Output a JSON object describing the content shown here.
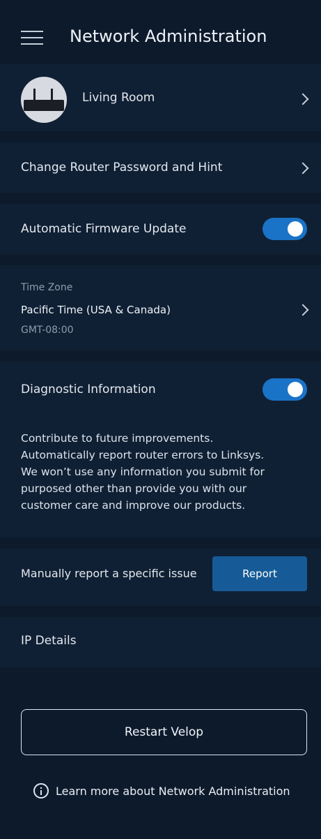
{
  "header": {
    "title": "Network Administration"
  },
  "device": {
    "name": "Living Room"
  },
  "password_row": {
    "label": "Change Router Password and Hint"
  },
  "firmware": {
    "label": "Automatic Firmware Update",
    "enabled": true
  },
  "timezone": {
    "label": "Time Zone",
    "value": "Pacific Time (USA & Canada)",
    "offset": "GMT-08:00"
  },
  "diagnostic": {
    "label": "Diagnostic Information",
    "enabled": true,
    "description": [
      "Contribute to future improvements.",
      "Automatically report router errors to Linksys.",
      "We won’t use any information you submit for",
      "purposed other than provide you with our",
      "customer care and improve our products."
    ]
  },
  "report": {
    "label": "Manually report a specific issue",
    "button_label": "Report"
  },
  "ip": {
    "label": "IP Details"
  },
  "restart": {
    "label": "Restart Velop"
  },
  "learn_more": {
    "label": "Learn more about Network Administration"
  },
  "colors": {
    "background": "#0d1a2b",
    "row_background": "#102034",
    "accent": "#1a73c6",
    "report_button": "#165b97"
  },
  "icons": {
    "menu": "hamburger-icon",
    "chevron": "chevron-right-icon",
    "info": "info-icon",
    "router": "router-image"
  }
}
